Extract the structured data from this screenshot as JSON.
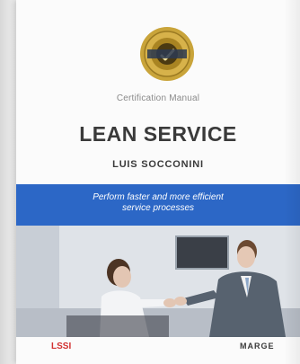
{
  "book": {
    "manual_label": "Certification Manual",
    "title": "LEAN SERVICE",
    "author": "LUIS SOCCONINI",
    "tagline_line1": "Perform faster and more efficient",
    "tagline_line2": "service processes",
    "publisher_left": "LSSI",
    "publisher_right": "MARGE"
  },
  "colors": {
    "accent_blue": "#2c67c6",
    "badge_gold": "#c9a43a"
  },
  "icons": {
    "badge": "certification-seal-icon"
  }
}
